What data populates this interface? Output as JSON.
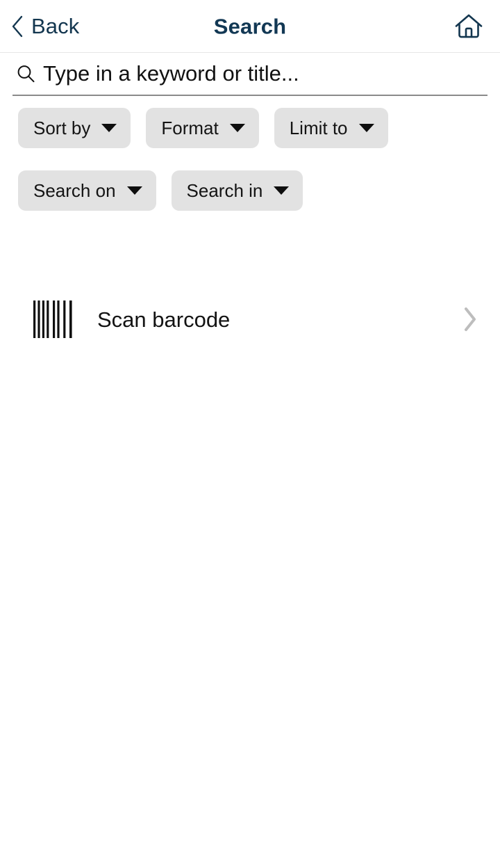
{
  "header": {
    "back_label": "Back",
    "title": "Search",
    "back_icon": "chevron-left-icon",
    "home_icon": "home-icon"
  },
  "search": {
    "icon": "search-icon",
    "placeholder": "Type in a keyword or title...",
    "value": ""
  },
  "filters": {
    "rows": [
      [
        {
          "label": "Sort by",
          "icon": "chevron-down-icon"
        },
        {
          "label": "Format",
          "icon": "chevron-down-icon"
        },
        {
          "label": "Limit to",
          "icon": "chevron-down-icon"
        }
      ],
      [
        {
          "label": "Search on",
          "icon": "chevron-down-icon"
        },
        {
          "label": "Search in",
          "icon": "chevron-down-icon"
        }
      ]
    ]
  },
  "scan": {
    "label": "Scan barcode",
    "icon": "barcode-icon",
    "chevron": "chevron-right-icon"
  },
  "colors": {
    "accent_navy": "#123854",
    "chip_background": "#e2e2e2",
    "text_primary": "#131313",
    "chevron_gray": "#bdbdbd",
    "divider": "#e6e6e6",
    "field_underline": "#8a8a8a"
  }
}
